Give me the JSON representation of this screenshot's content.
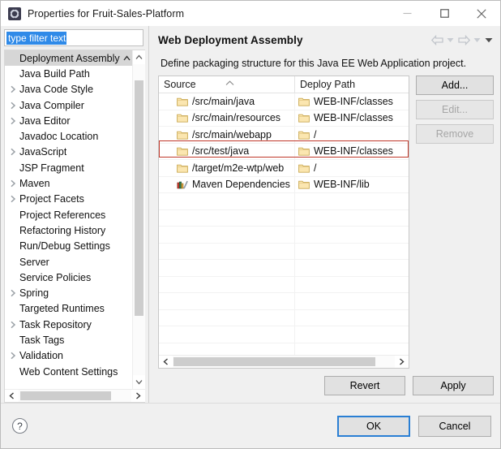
{
  "window": {
    "title": "Properties for Fruit-Sales-Platform",
    "icon": "eclipse-properties-icon",
    "minimize_label": "Minimize",
    "maximize_label": "Maximize",
    "close_label": "Close"
  },
  "filter": {
    "value": "type filter text",
    "placeholder": "type filter text"
  },
  "sidebar": {
    "items": [
      {
        "label": "Deployment Assembly",
        "expandable": false,
        "selected": true
      },
      {
        "label": "Java Build Path",
        "expandable": false,
        "selected": false
      },
      {
        "label": "Java Code Style",
        "expandable": true,
        "selected": false
      },
      {
        "label": "Java Compiler",
        "expandable": true,
        "selected": false
      },
      {
        "label": "Java Editor",
        "expandable": true,
        "selected": false
      },
      {
        "label": "Javadoc Location",
        "expandable": false,
        "selected": false
      },
      {
        "label": "JavaScript",
        "expandable": true,
        "selected": false
      },
      {
        "label": "JSP Fragment",
        "expandable": false,
        "selected": false
      },
      {
        "label": "Maven",
        "expandable": true,
        "selected": false
      },
      {
        "label": "Project Facets",
        "expandable": true,
        "selected": false
      },
      {
        "label": "Project References",
        "expandable": false,
        "selected": false
      },
      {
        "label": "Refactoring History",
        "expandable": false,
        "selected": false
      },
      {
        "label": "Run/Debug Settings",
        "expandable": false,
        "selected": false
      },
      {
        "label": "Server",
        "expandable": false,
        "selected": false
      },
      {
        "label": "Service Policies",
        "expandable": false,
        "selected": false
      },
      {
        "label": "Spring",
        "expandable": true,
        "selected": false
      },
      {
        "label": "Targeted Runtimes",
        "expandable": false,
        "selected": false
      },
      {
        "label": "Task Repository",
        "expandable": true,
        "selected": false
      },
      {
        "label": "Task Tags",
        "expandable": false,
        "selected": false
      },
      {
        "label": "Validation",
        "expandable": true,
        "selected": false
      },
      {
        "label": "Web Content Settings",
        "expandable": false,
        "selected": false
      }
    ]
  },
  "page": {
    "title": "Web Deployment Assembly",
    "description": "Define packaging structure for this Java EE Web Application project.",
    "nav": {
      "back": "back-arrow",
      "back_menu": "back-dropdown",
      "forward": "forward-arrow",
      "forward_menu": "forward-dropdown",
      "view_menu": "view-menu"
    }
  },
  "table": {
    "columns": [
      "Source",
      "Deploy Path"
    ],
    "sort_column": "Source",
    "sort_direction": "ascending",
    "rows": [
      {
        "source": "/src/main/java",
        "deploy": "WEB-INF/classes",
        "icon": "folder-icon",
        "highlighted": false
      },
      {
        "source": "/src/main/resources",
        "deploy": "WEB-INF/classes",
        "icon": "folder-icon",
        "highlighted": false
      },
      {
        "source": "/src/main/webapp",
        "deploy": "/",
        "icon": "folder-icon",
        "highlighted": false
      },
      {
        "source": "/src/test/java",
        "deploy": "WEB-INF/classes",
        "icon": "folder-icon",
        "highlighted": true
      },
      {
        "source": "/target/m2e-wtp/web",
        "deploy": "/",
        "icon": "folder-icon",
        "highlighted": false
      },
      {
        "source": "Maven Dependencies",
        "deploy": "WEB-INF/lib",
        "icon": "library-icon",
        "highlighted": false
      }
    ],
    "highlight_color": "#c0392b"
  },
  "side_buttons": [
    {
      "label": "Add...",
      "enabled": true
    },
    {
      "label": "Edit...",
      "enabled": false
    },
    {
      "label": "Remove",
      "enabled": false
    }
  ],
  "apply_buttons": [
    {
      "label": "Revert",
      "enabled": true
    },
    {
      "label": "Apply",
      "enabled": true
    }
  ],
  "footer": {
    "help": "help-icon",
    "ok": "OK",
    "cancel": "Cancel"
  },
  "colors": {
    "accent": "#2a7fd4",
    "selection": "#2f8ae8",
    "highlight": "#c0392b",
    "folder": "#f5d98a"
  }
}
